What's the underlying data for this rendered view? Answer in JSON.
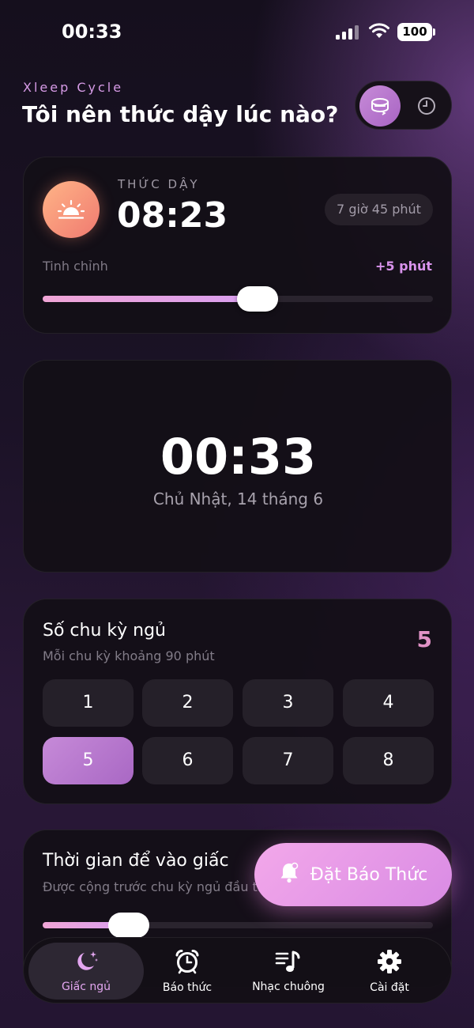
{
  "status_bar": {
    "time": "00:33",
    "battery": "100"
  },
  "header": {
    "brand": "Xleep Cycle",
    "title": "Tôi nên thức dậy lúc nào?"
  },
  "mode_toggle": {
    "active_icon": "bed-cycle-icon",
    "inactive_icon": "clock-icon"
  },
  "wake_card": {
    "label": "THỨC DẬY",
    "time": "08:23",
    "duration": "7 giờ 45 phút",
    "fine_tune_label": "Tinh chỉnh",
    "fine_tune_value": "+5 phút",
    "fine_tune_level": 0.55
  },
  "clock_card": {
    "time": "00:33",
    "date": "Chủ Nhật, 14 tháng 6"
  },
  "cycles": {
    "title": "Số chu kỳ ngủ",
    "subtitle": "Mỗi chu kỳ khoảng 90 phút",
    "selected_display": "5",
    "options": [
      "1",
      "2",
      "3",
      "4",
      "5",
      "6",
      "7",
      "8"
    ],
    "selected_index": 4
  },
  "fall_asleep": {
    "title": "Thời gian để vào giấc",
    "subtitle": "Được cộng trước chu kỳ ngủ đầu tiên",
    "level": 0.22
  },
  "cta": {
    "label": "Đặt Báo Thức",
    "icon": "bell-icon"
  },
  "nav": {
    "items": [
      {
        "label": "Giấc ngủ",
        "icon": "moon-stars-icon",
        "active": true
      },
      {
        "label": "Báo thức",
        "icon": "alarm-clock-icon",
        "active": false
      },
      {
        "label": "Nhạc chuông",
        "icon": "music-list-icon",
        "active": false
      },
      {
        "label": "Cài đặt",
        "icon": "gear-icon",
        "active": false
      }
    ]
  },
  "colors": {
    "accent": "#d993ec",
    "accent_pink": "#e192c6",
    "sun_gradient": "#f07a70",
    "card_bg": "#130f16"
  }
}
